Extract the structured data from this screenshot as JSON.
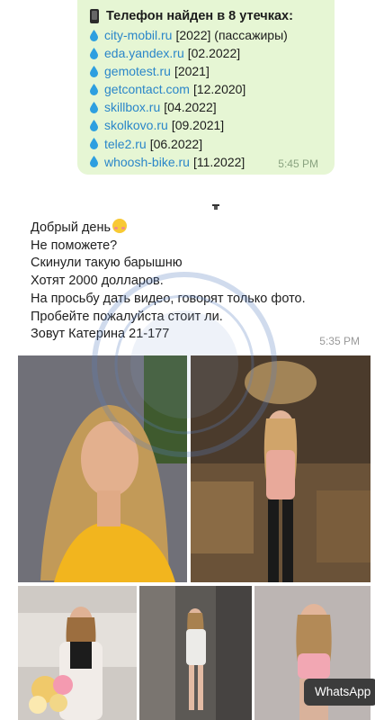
{
  "leak_report": {
    "title": "Телефон найден в 8 утечках:",
    "items": [
      {
        "domain": "city-mobil.ru",
        "date": "[2022] (пассажиры)"
      },
      {
        "domain": "eda.yandex.ru",
        "date": "[02.2022]"
      },
      {
        "domain": "gemotest.ru",
        "date": "[2021]"
      },
      {
        "domain": "getcontact.com",
        "date": "[12.2020]"
      },
      {
        "domain": "skillbox.ru",
        "date": "[04.2022]"
      },
      {
        "domain": "skolkovo.ru",
        "date": "[09.2021]"
      },
      {
        "domain": "tele2.ru",
        "date": "[06.2022]"
      },
      {
        "domain": "whoosh-bike.ru",
        "date": "[11.2022]"
      }
    ],
    "time": "5:45 PM"
  },
  "message": {
    "lines": [
      "Добрый день",
      "Не поможете?",
      "Скинули такую барышню",
      "Хотят 2000 долларов.",
      "На просьбу дать видео, говорят только фото.",
      "Пробейте пожалуйста стоит ли.",
      "Зовут Катерина 21-177"
    ],
    "time": "5:35 PM"
  },
  "photos": {
    "count": 5
  },
  "badge": {
    "label": "WhatsApp"
  },
  "colors": {
    "leak_bubble": "#e6f6d4",
    "link": "#2a86c9",
    "drop": "#2d9fe0",
    "time_green": "#8aa380",
    "badge_bg": "#3c3c3c"
  },
  "icons": [
    "phone-icon",
    "water-drop-icon",
    "smiling-face-icon",
    "document-icon"
  ]
}
